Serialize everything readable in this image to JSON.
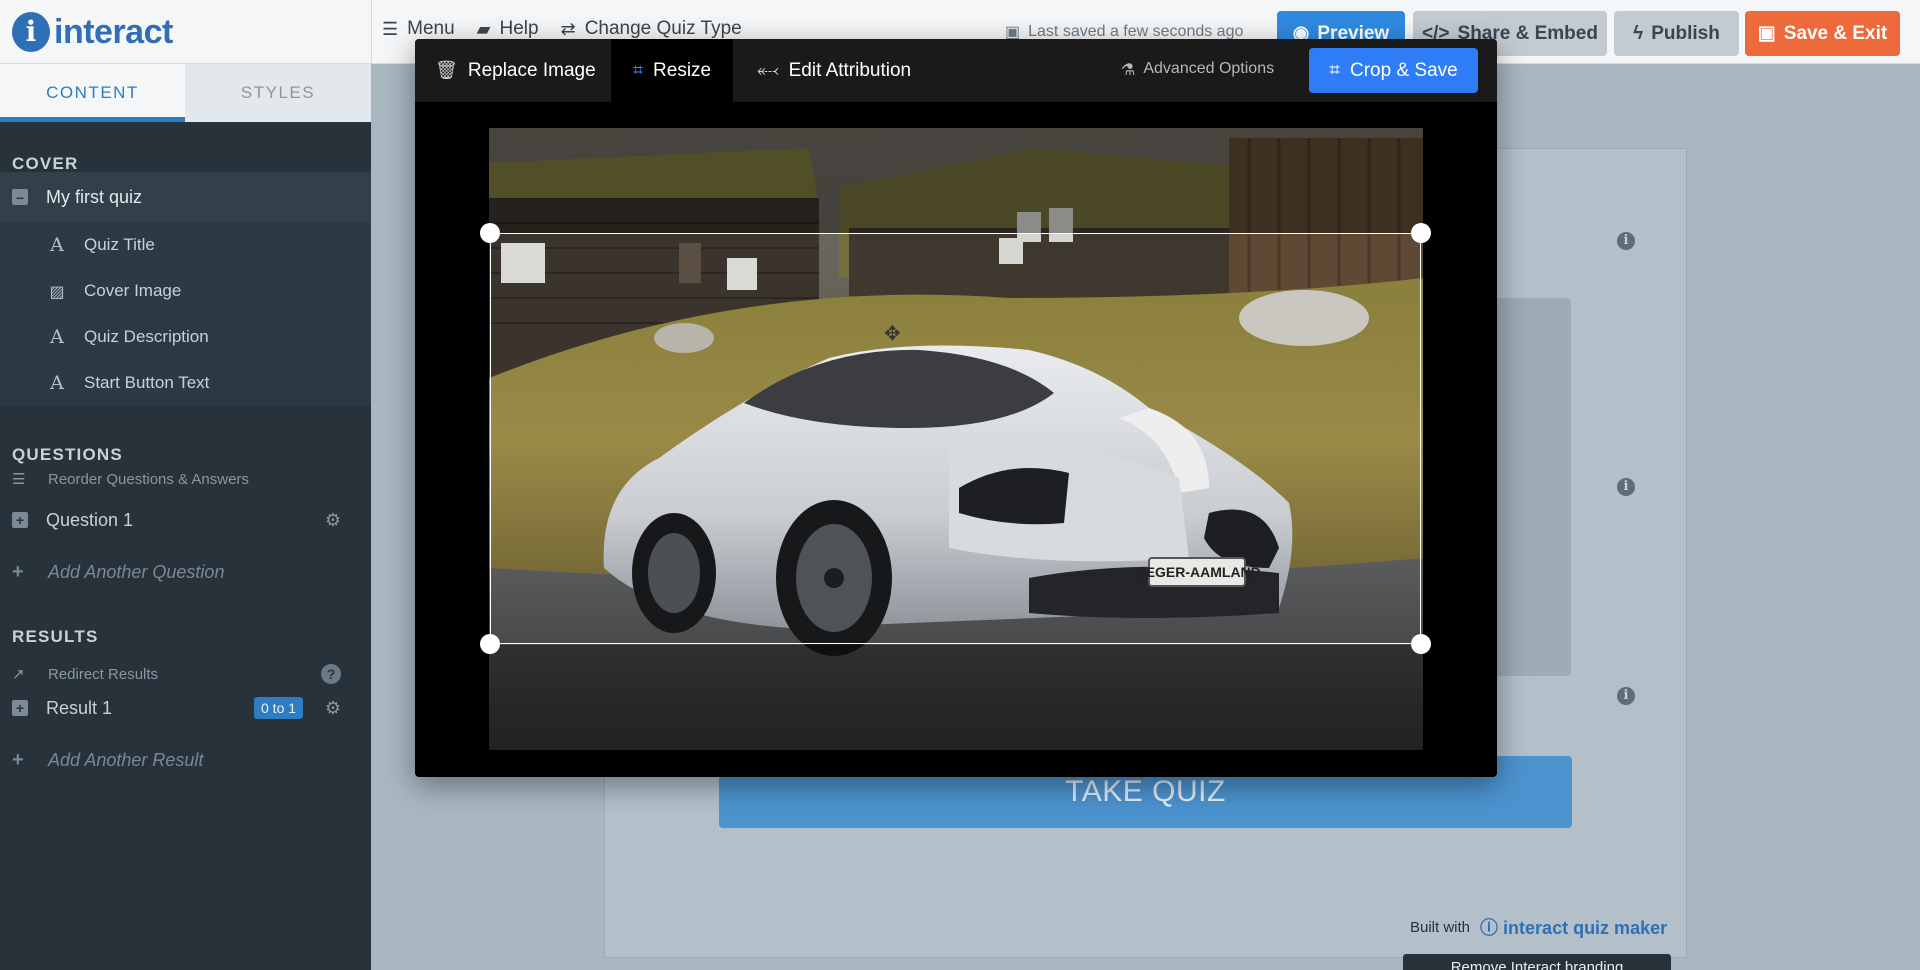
{
  "topbar": {
    "logo_text": "interact",
    "nav": {
      "menu": "Menu",
      "help": "Help",
      "change_type": "Change Quiz Type"
    },
    "saved_status": "Last saved a few seconds ago",
    "buttons": {
      "preview": "Preview",
      "share": "Share & Embed",
      "publish": "Publish",
      "save_exit": "Save & Exit"
    }
  },
  "sidebar": {
    "tabs": {
      "content": "CONTENT",
      "styles": "STYLES"
    },
    "cover": {
      "heading": "COVER",
      "quiz_name": "My first quiz",
      "items": [
        "Quiz Title",
        "Cover Image",
        "Quiz Description",
        "Start Button Text"
      ]
    },
    "questions": {
      "heading": "QUESTIONS",
      "reorder": "Reorder Questions & Answers",
      "question1": "Question 1",
      "add": "Add Another Question"
    },
    "results": {
      "heading": "RESULTS",
      "redirect": "Redirect Results",
      "result1": "Result 1",
      "result1_badge": "0 to 1",
      "add": "Add Another Result"
    }
  },
  "canvas": {
    "take_quiz": "TAKE QUIZ",
    "built_with": "Built with",
    "brand": "interact quiz maker",
    "remove_branding": "Remove Interact branding"
  },
  "modal": {
    "tabs": {
      "replace": "Replace Image",
      "resize": "Resize",
      "attribution": "Edit Attribution"
    },
    "advanced": "Advanced Options",
    "crop_save": "Crop & Save",
    "plate": "JÆGER-AAMLAND"
  },
  "colors": {
    "brand_blue": "#2f6fb6",
    "primary_blue": "#2f7df6",
    "save_exit_orange": "#ec6a3b",
    "sidebar_dark": "#27323a"
  }
}
